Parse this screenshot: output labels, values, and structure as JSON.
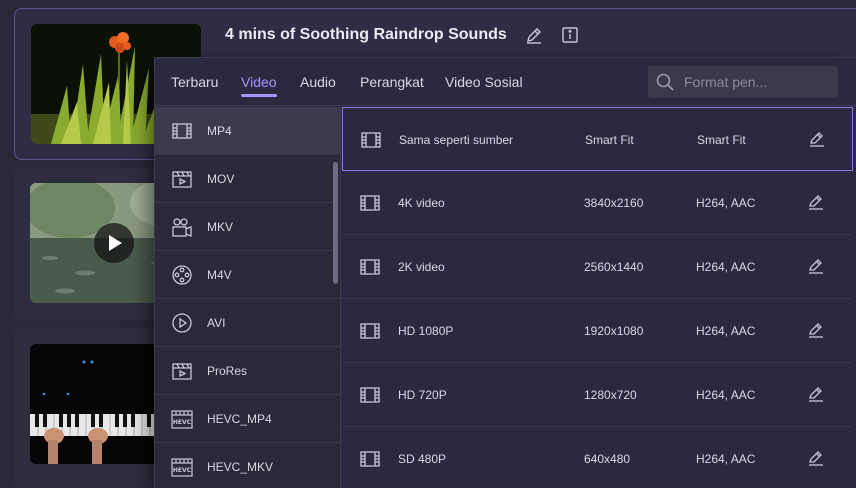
{
  "cards": [
    {
      "title": "4 mins of Soothing Raindrop Sounds"
    },
    {
      "title": ""
    },
    {
      "title": ""
    }
  ],
  "popup": {
    "tabs": [
      {
        "label": "Terbaru",
        "active": false
      },
      {
        "label": "Video",
        "active": true
      },
      {
        "label": "Audio",
        "active": false
      },
      {
        "label": "Perangkat",
        "active": false
      },
      {
        "label": "Video Sosial",
        "active": false
      }
    ],
    "search": {
      "placeholder": "Format pen...",
      "value": ""
    },
    "formats": [
      {
        "label": "MP4",
        "icon": "film-icon",
        "selected": true
      },
      {
        "label": "MOV",
        "icon": "clapper-icon",
        "selected": false
      },
      {
        "label": "MKV",
        "icon": "camera-icon",
        "selected": false
      },
      {
        "label": "M4V",
        "icon": "reel-icon",
        "selected": false
      },
      {
        "label": "AVI",
        "icon": "play-circle-icon",
        "selected": false
      },
      {
        "label": "ProRes",
        "icon": "clapper-icon",
        "selected": false
      },
      {
        "label": "HEVC_MP4",
        "icon": "hevc-icon",
        "selected": false
      },
      {
        "label": "HEVC_MKV",
        "icon": "hevc-icon",
        "selected": false
      }
    ],
    "presets": [
      {
        "name": "Sama seperti sumber",
        "resolution": "Smart Fit",
        "codec": "Smart Fit",
        "selected": true
      },
      {
        "name": "4K video",
        "resolution": "3840x2160",
        "codec": "H264, AAC",
        "selected": false
      },
      {
        "name": "2K video",
        "resolution": "2560x1440",
        "codec": "H264, AAC",
        "selected": false
      },
      {
        "name": "HD 1080P",
        "resolution": "1920x1080",
        "codec": "H264, AAC",
        "selected": false
      },
      {
        "name": "HD 720P",
        "resolution": "1280x720",
        "codec": "H264, AAC",
        "selected": false
      },
      {
        "name": "SD 480P",
        "resolution": "640x480",
        "codec": "H264, AAC",
        "selected": false
      }
    ]
  },
  "colors": {
    "accent": "#a796ff",
    "selection_border": "#8a79e8",
    "background": "#2a2838"
  }
}
